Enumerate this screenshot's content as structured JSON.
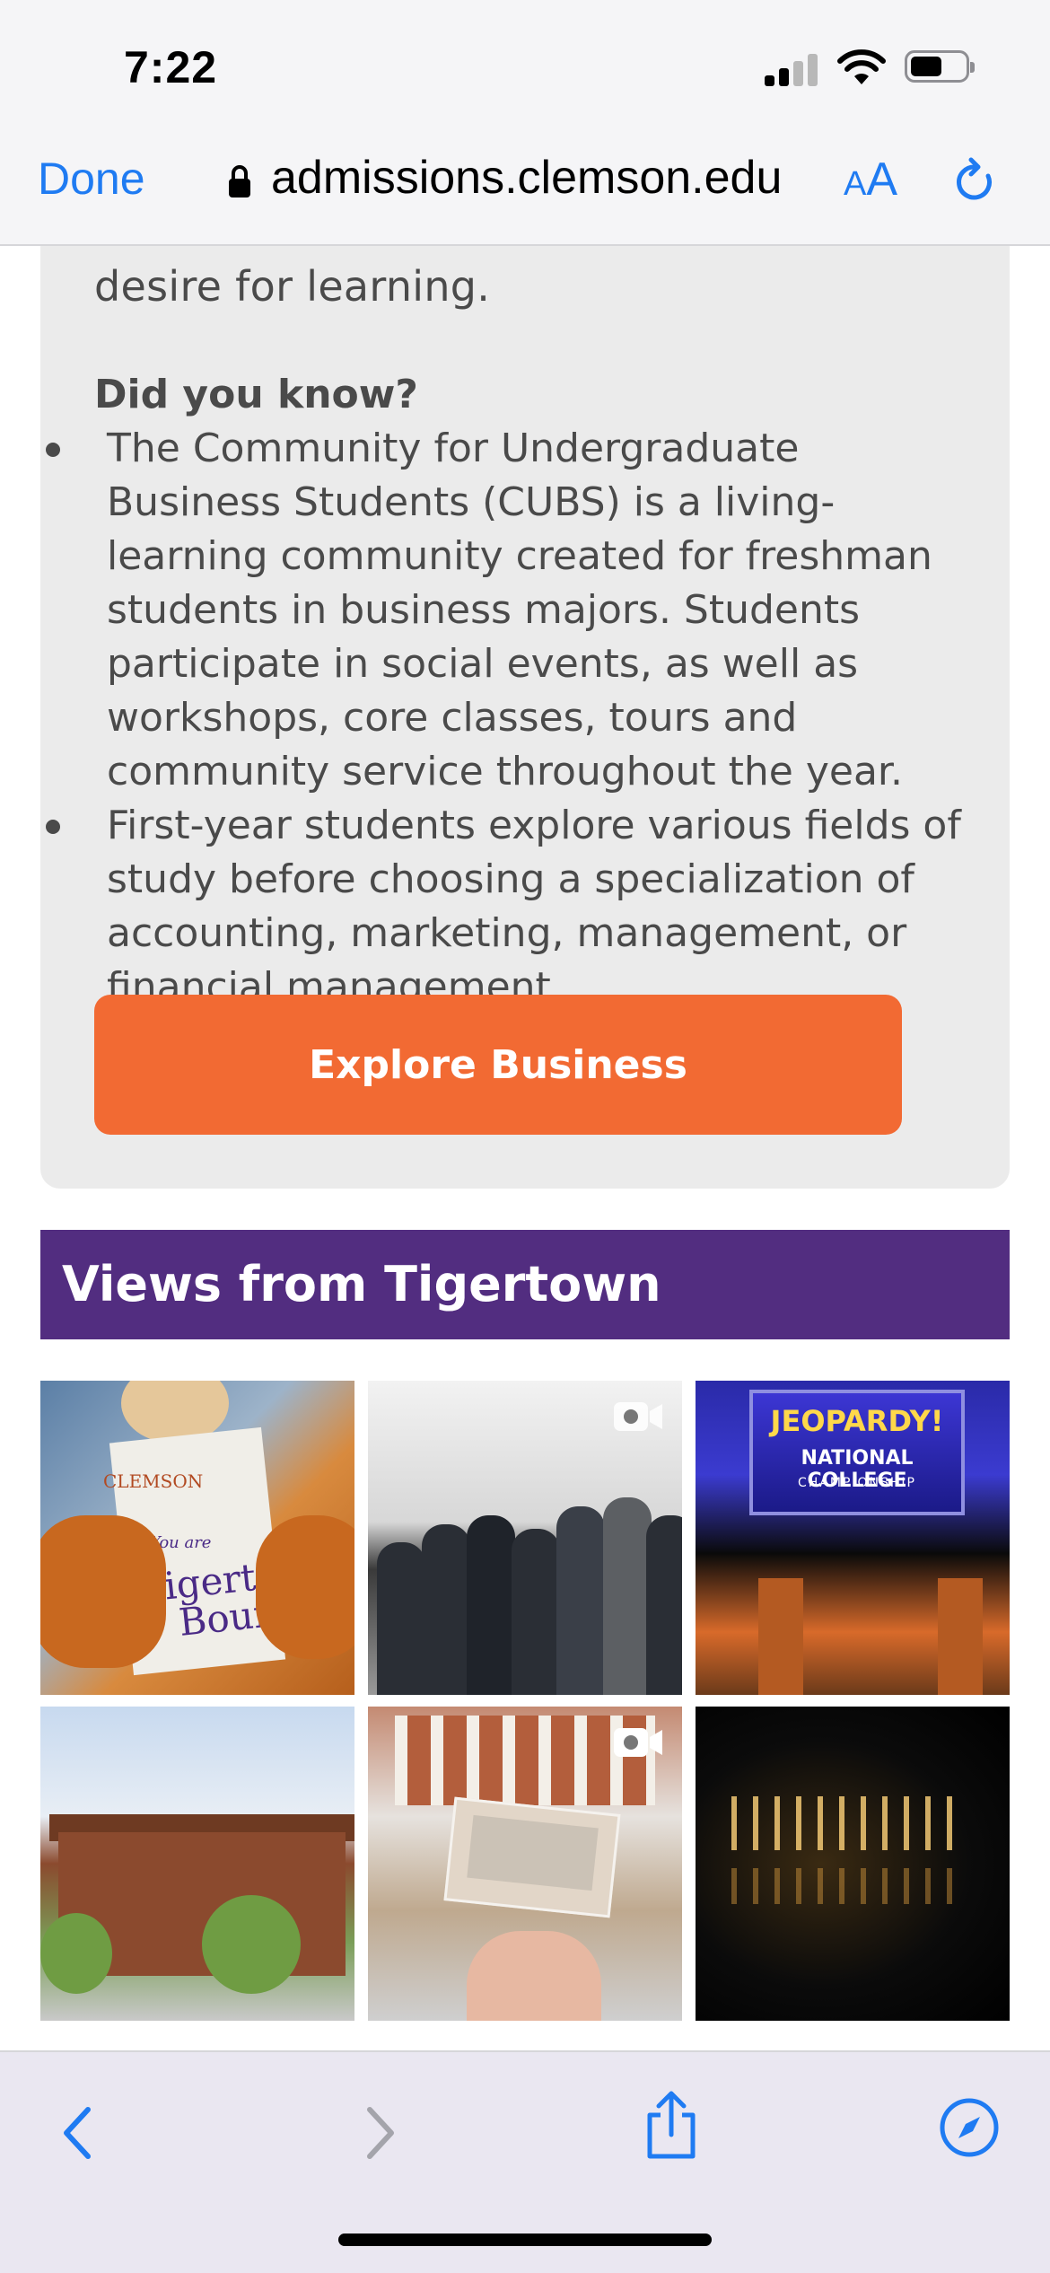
{
  "status_bar": {
    "time": "7:22"
  },
  "browser": {
    "done_label": "Done",
    "url": "admissions.clemson.edu",
    "text_size_small": "A",
    "text_size_large": "A"
  },
  "info_card": {
    "intro_tail": "desire for learning.",
    "did_you_know_heading": "Did you know?",
    "bullets": [
      "The Community for Undergraduate Business Students (CUBS) is a living-learning community created for freshman students in business majors. Students participate in social events, as well as workshops, core classes, tours and community service throughout the year.",
      "First-year students explore various fields of study before choosing a specialization of accounting, marketing, management, or financial management."
    ],
    "cta_label": "Explore Business"
  },
  "gallery": {
    "heading": "Views from Tigertown",
    "tiles": [
      {
        "name": "tiger-mascot-admission-letter",
        "clemson": "CLEMSON",
        "you_are": "You are",
        "line1": "Tigertown",
        "line2": "Bound"
      },
      {
        "name": "group-officials-ceremony",
        "video": false
      },
      {
        "name": "jeopardy-national-college-championship",
        "title": "JEOPARDY!",
        "line1": "NATIONAL COLLEGE",
        "line2": "CHAMPIONSHIP"
      },
      {
        "name": "brick-campus-building"
      },
      {
        "name": "postcard-held-in-front-of-building",
        "video": true
      },
      {
        "name": "campus-at-night-reflection"
      }
    ]
  },
  "icons": {
    "lock": "lock-icon",
    "reload": "reload-icon",
    "back": "chevron-left-icon",
    "forward": "chevron-right-icon",
    "share": "share-icon",
    "compass": "compass-icon",
    "video": "video-camera-icon"
  },
  "colors": {
    "accent_blue": "#1f7bf2",
    "cta_orange": "#f26a33",
    "heading_purple": "#522d80",
    "card_gray": "#ebebeb"
  }
}
